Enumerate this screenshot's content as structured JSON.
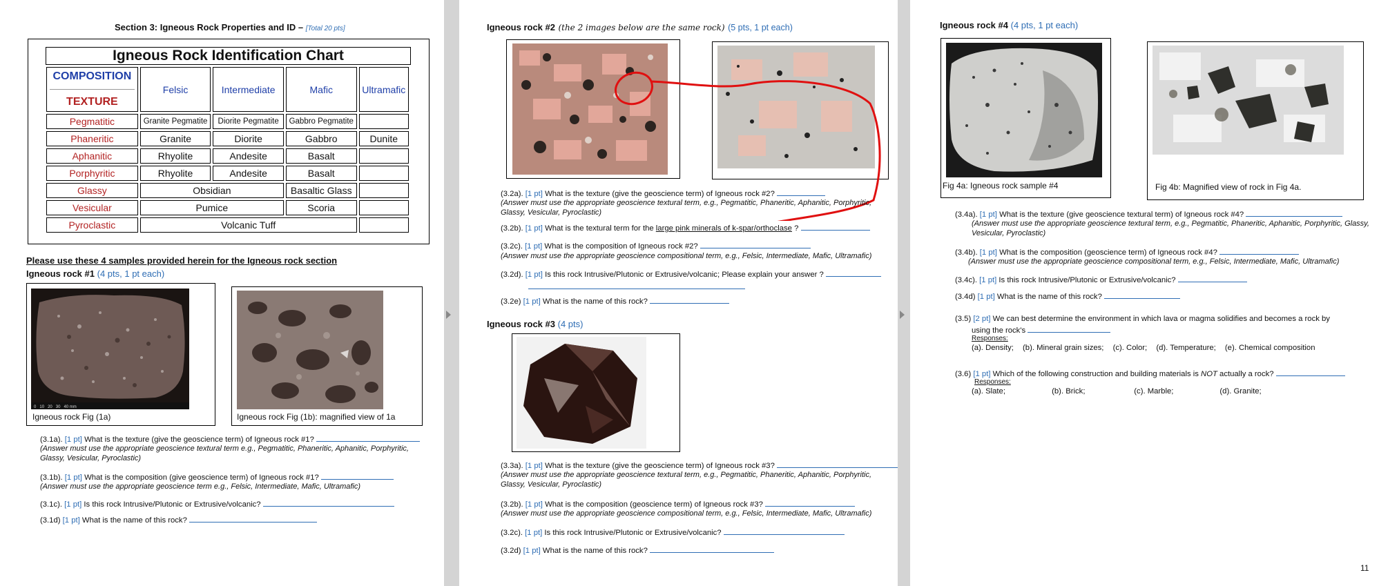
{
  "left_page": {
    "section_title": "Section 3: Igneous Rock Properties and ID –",
    "section_total": "[Total 20 pts]",
    "chart": {
      "title": "Igneous Rock Identification Chart",
      "composition_label": "COMPOSITION",
      "texture_label": "TEXTURE",
      "columns": [
        "Felsic",
        "Intermediate",
        "Mafic",
        "Ultramafic"
      ],
      "rows": [
        {
          "texture": "Pegmatitic",
          "felsic": "Granite Pegmatite",
          "intermediate": "Diorite Pegmatite",
          "mafic": "Gabbro Pegmatite",
          "ultramafic": ""
        },
        {
          "texture": "Phaneritic",
          "felsic": "Granite",
          "intermediate": "Diorite",
          "mafic": "Gabbro",
          "ultramafic": "Dunite"
        },
        {
          "texture": "Aphanitic",
          "felsic": "Rhyolite",
          "intermediate": "Andesite",
          "mafic": "Basalt",
          "ultramafic": ""
        },
        {
          "texture": "Porphyritic",
          "felsic": "Rhyolite",
          "intermediate": "Andesite",
          "mafic": "Basalt",
          "ultramafic": ""
        },
        {
          "texture": "Glassy",
          "felsic_intermediate": "Obsidian",
          "mafic": "Basaltic Glass",
          "ultramafic": ""
        },
        {
          "texture": "Vesicular",
          "felsic_intermediate": "Pumice",
          "mafic": "Scoria",
          "ultramafic": ""
        },
        {
          "texture": "Pyroclastic",
          "span3": "Volcanic Tuff",
          "ultramafic": ""
        }
      ]
    },
    "instruction": "Please use these 4 samples provided herein for the Igneous rock section",
    "rock1_heading": "Igneous rock #1",
    "rock1_points": "(4 pts, 1 pt each)",
    "fig1a_caption": "Igneous rock Fig (1a)",
    "fig1b_caption": "Igneous rock Fig (1b): magnified view of 1a",
    "scale_labels": [
      "0",
      "10",
      "20",
      "30",
      "40 mm"
    ],
    "q31a_label": "(3.1a).",
    "q31a_pts": "[1 pt]",
    "q31a_text": "What is the texture (give the geoscience term) of Igneous rock #1?",
    "q31a_note": "(Answer must use the appropriate geoscience textural term e.g., Pegmatitic, Phaneritic, Aphanitic, Porphyritic, Glassy, Vesicular, Pyroclastic)",
    "q31b_label": "(3.1b).",
    "q31b_pts": "[1 pt]",
    "q31b_text": "What is the composition (give geoscience term)  of Igneous rock #1?",
    "q31b_note": "(Answer must use the appropriate geoscience term e.g., Felsic, Intermediate, Mafic, Ultramafic)",
    "q31c_label": "(3.1c).",
    "q31c_pts": "[1 pt]",
    "q31c_text": "Is this rock Intrusive/Plutonic or Extrusive/volcanic?",
    "q31d_label": "(3.1d)",
    "q31d_pts": "[1 pt]",
    "q31d_text": "What is the name of this rock?"
  },
  "middle_page": {
    "rock2_heading": "Igneous rock #2",
    "rock2_note": "(the 2 images below are the same rock)",
    "rock2_points": "(5 pts, 1 pt each)",
    "q32a_label": "(3.2a).",
    "q32a_pts": "[1 pt]",
    "q32a_text": "What is the texture (give the geoscience term) of Igneous rock #2?",
    "q32a_note": "(Answer must use the appropriate geoscience textural term, e.g., Pegmatitic, Phaneritic, Aphanitic, Porphyritic, Glassy, Vesicular, Pyroclastic)",
    "q32b_label": "(3.2b).",
    "q32b_pts": "[1 pt]",
    "q32b_text_pre": "What is the textural term for the ",
    "q32b_text_u": "large pink minerals of k-spar/orthoclase",
    "q32b_text_post": " ?",
    "q32c_label": "(3.2c).",
    "q32c_pts": "[1 pt]",
    "q32c_text": "What is the composition of Igneous rock #2?",
    "q32c_note": "(Answer must use the appropriate geoscience compositional term, e.g., Felsic, Intermediate, Mafic, Ultramafic)",
    "q32d_label": "(3.2d).",
    "q32d_pts": "[1 pt]",
    "q32d_text": "Is this rock Intrusive/Plutonic or Extrusive/volcanic; Please explain your answer ?",
    "q32e_label": "(3.2e)",
    "q32e_pts": "[1 pt]",
    "q32e_text": "What is the name of this rock?",
    "rock3_heading": "Igneous rock #3",
    "rock3_points": "(4 pts)",
    "q33a_label": "(3.3a).",
    "q33a_pts": "[1 pt]",
    "q33a_text": "What is the texture (give the geoscience term) of Igneous rock #3?",
    "q33a_note": "(Answer must use the appropriate geoscience textural term, e.g., Pegmatitic, Phaneritic, Aphanitic, Porphyritic, Glassy, Vesicular, Pyroclastic)",
    "q33b_label": "(3.2b).",
    "q33b_pts": "[1 pt]",
    "q33b_text": "What is the composition (geoscience term) of Igneous rock #3?",
    "q33b_note": "(Answer must use the appropriate geoscience compositional term, e.g., Felsic, Intermediate, Mafic, Ultramafic)",
    "q33c_label": "(3.2c).",
    "q33c_pts": "[1 pt]",
    "q33c_text": "Is this rock Intrusive/Plutonic or Extrusive/volcanic?",
    "q33d_label": "(3.2d)",
    "q33d_pts": "[1 pt]",
    "q33d_text": "What is the name of this rock?"
  },
  "right_page": {
    "rock4_heading": "Igneous rock #4",
    "rock4_points": "(4 pts, 1 pt each)",
    "fig4a_caption": "Fig 4a: Igneous rock sample #4",
    "fig4b_caption": "Fig 4b: Magnified view of rock in Fig 4a.",
    "q34a_label": "(3.4a).",
    "q34a_pts": "[1 pt]",
    "q34a_text": "What is the texture (give geoscience textural term) of Igneous rock #4?",
    "q34a_note": "(Answer must use the appropriate geoscience textural term, e.g.,  Pegmatitic, Phaneritic, Aphanitic, Porphyritic, Glassy, Vesicular, Pyroclastic)",
    "q34b_label": "(3.4b).",
    "q34b_pts": "[1 pt]",
    "q34b_text": "What is the composition (geoscience term) of Igneous rock #4?",
    "q34b_note": "(Answer must use the appropriate geoscience compositional term, e.g., Felsic, Intermediate, Mafic, Ultramafic)",
    "q34c_label": "(3.4c).",
    "q34c_pts": "[1 pt]",
    "q34c_text": "Is this rock Intrusive/Plutonic or Extrusive/volcanic?",
    "q34d_label": "(3.4d)",
    "q34d_pts": "[1 pt]",
    "q34d_text": "What is the name of this rock?",
    "q35_label": "(3.5)",
    "q35_pts": "[2 pt]",
    "q35_text": "We can best determine the environment in which lava or magma solidifies and becomes a rock by",
    "q35_text2": "using the rock's",
    "q35_responses_label": "Responses:",
    "q35_responses": [
      "(a). Density;",
      "(b). Mineral grain sizes;",
      "(c). Color;",
      "(d). Temperature;",
      "(e). Chemical composition"
    ],
    "q36_label": "(3.6)",
    "q36_pts": "[1 pt]",
    "q36_text_pre": "Which of the following construction and building materials is ",
    "q36_text_em": "NOT",
    "q36_text_post": " actually a rock?",
    "q36_responses_label": "Responses:",
    "q36_responses": [
      "(a). Slate;",
      "(b). Brick;",
      "(c). Marble;",
      "(d). Granite;"
    ],
    "page_number": "11"
  },
  "colors": {
    "accent_blue": "#2e6db4",
    "texture_red": "#b22222",
    "composition_blue": "#1f3fa8",
    "annotation_red": "#e01010"
  }
}
